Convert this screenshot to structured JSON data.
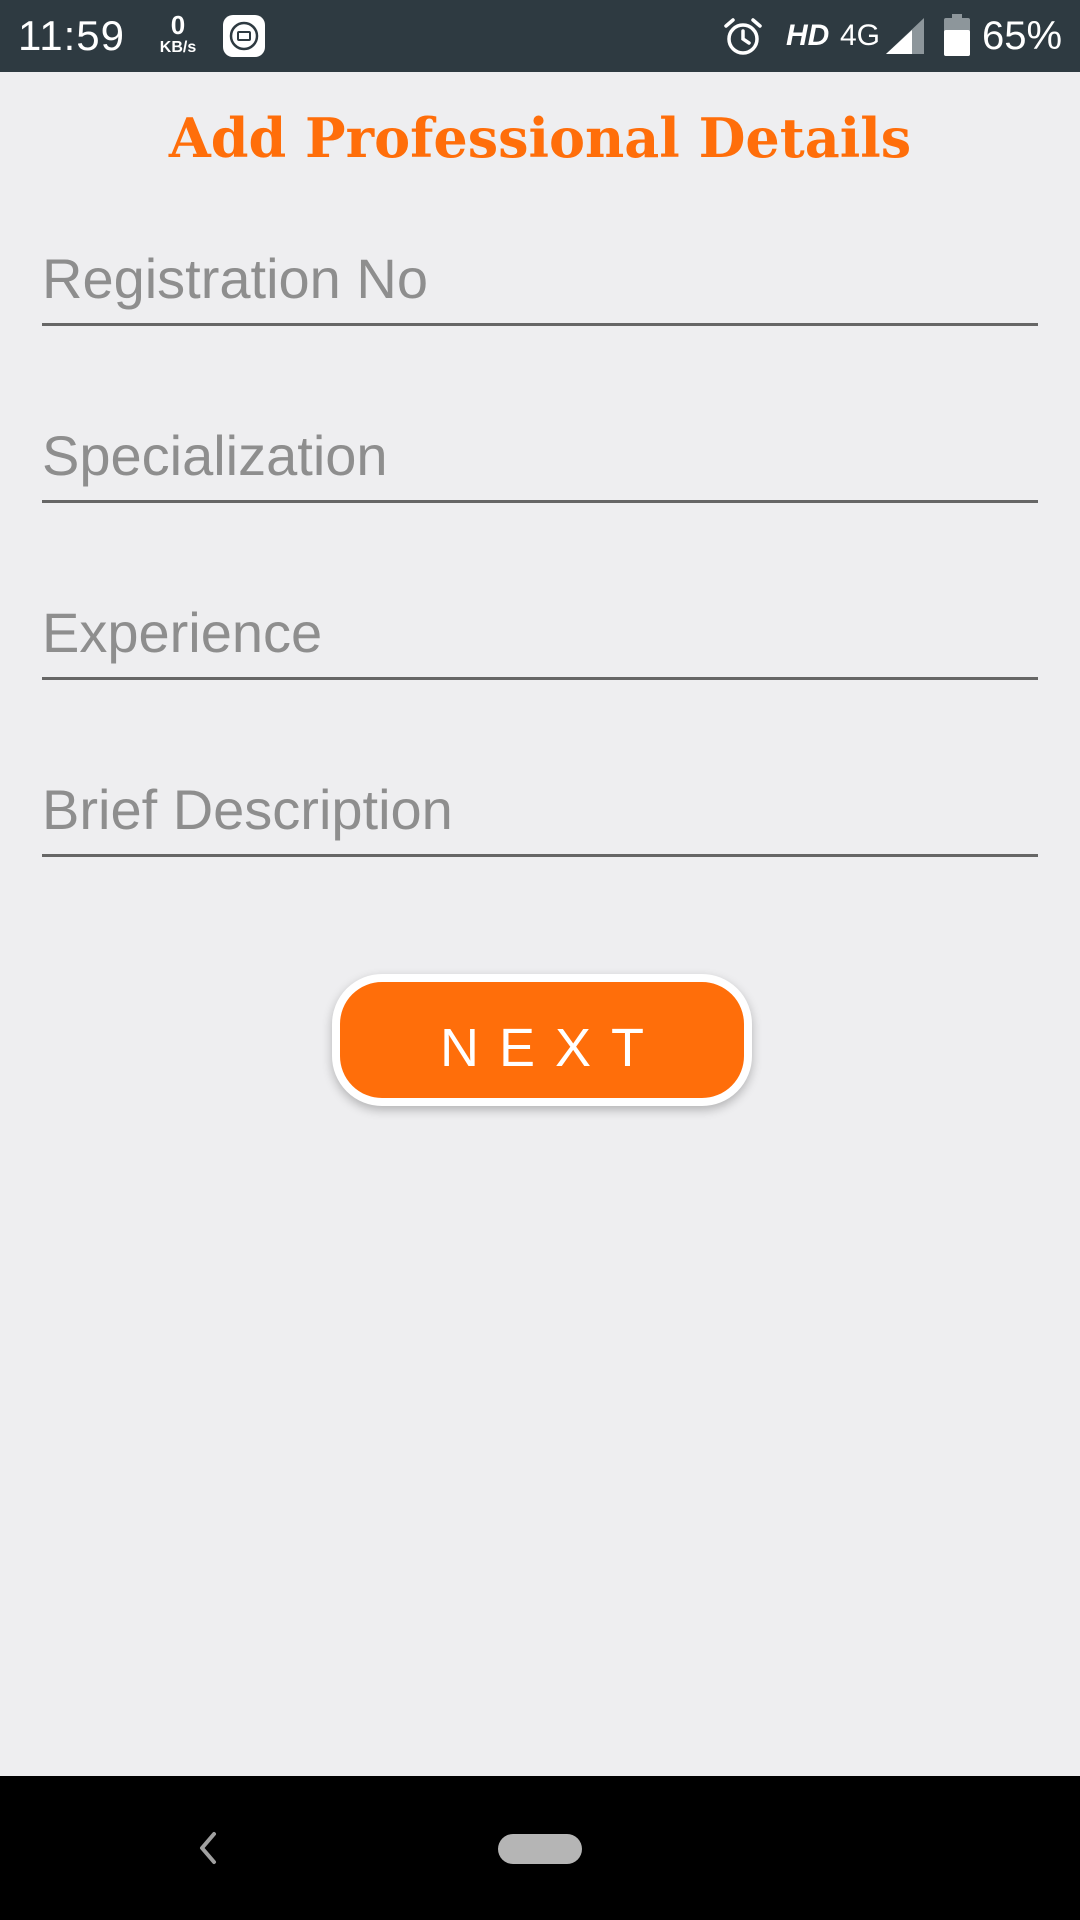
{
  "status_bar": {
    "time": "11:59",
    "net_speed_value": "0",
    "net_speed_unit": "KB/s",
    "hd_label": "HD",
    "network_type": "4G",
    "battery_percent": "65%",
    "icons": [
      "mi-app-icon",
      "alarm-icon",
      "signal-icon",
      "battery-icon"
    ]
  },
  "title": "Add Professional Details",
  "form": {
    "fields": [
      {
        "placeholder": "Registration No",
        "value": ""
      },
      {
        "placeholder": "Specialization",
        "value": ""
      },
      {
        "placeholder": "Experience",
        "value": ""
      },
      {
        "placeholder": "Brief Description",
        "value": ""
      }
    ],
    "next_label": "NEXT"
  },
  "nav_bar": {
    "icons": [
      "back-icon",
      "home-pill-icon"
    ]
  },
  "colors": {
    "accent": "#ff6e0a",
    "background": "#eeeef0",
    "status_bar": "#2e3a41",
    "placeholder": "#8e8e8e",
    "underline": "#666666"
  }
}
